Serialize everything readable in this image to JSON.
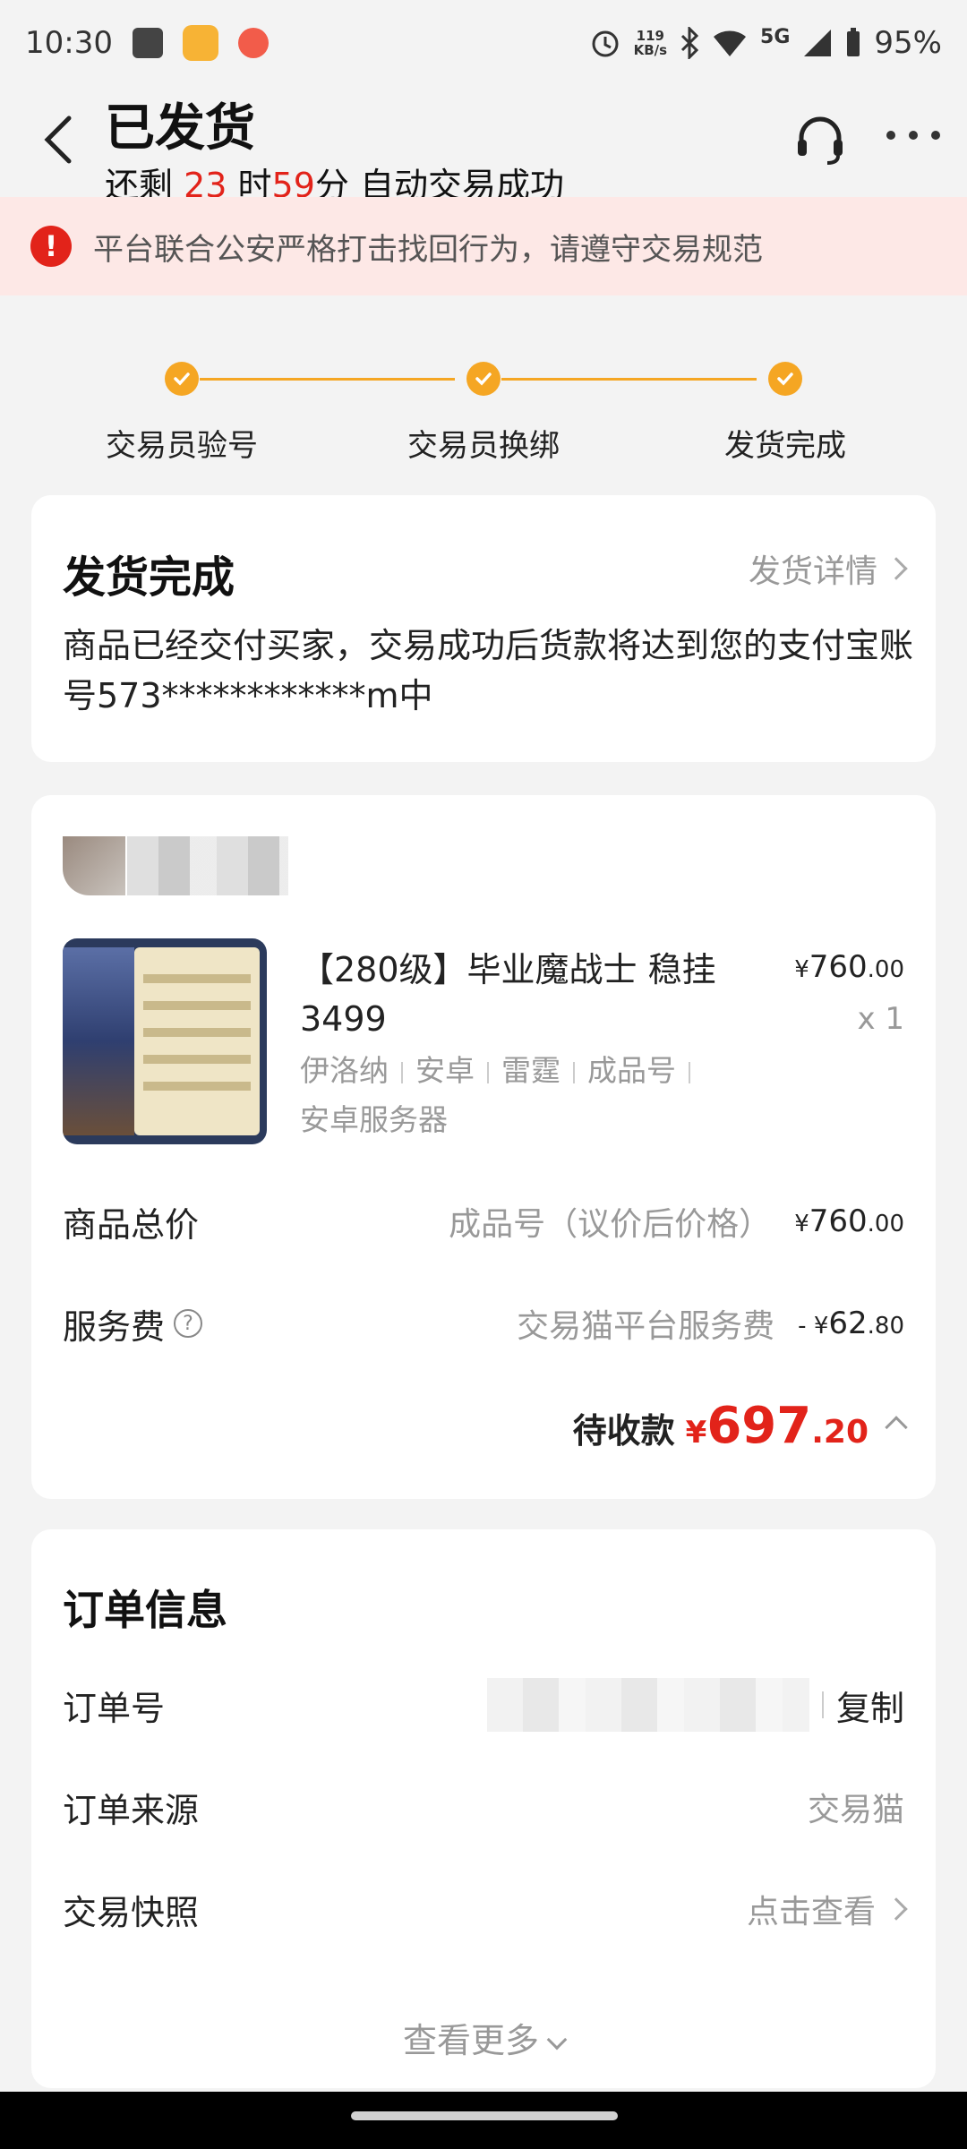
{
  "status_bar": {
    "time": "10:30",
    "net_speed_value": "119",
    "net_speed_unit": "KB/s",
    "network": "5G",
    "battery": "95%"
  },
  "header": {
    "title": "已发货",
    "countdown_prefix": "还剩 ",
    "hours": "23",
    "hours_unit": " 时",
    "minutes": "59",
    "minutes_unit": "分 自动交易成功"
  },
  "notice": {
    "icon": "!",
    "text": "平台联合公安严格打击找回行为，请遵守交易规范"
  },
  "steps": [
    {
      "label": "交易员验号"
    },
    {
      "label": "交易员换绑"
    },
    {
      "label": "发货完成"
    }
  ],
  "delivery_card": {
    "title": "发货完成",
    "detail_link": "发货详情",
    "description": "商品已经交付买家，交易成功后货款将达到您的支付宝账号573************m中"
  },
  "product": {
    "title": "【280级】毕业魔战士 稳挂3499",
    "tags": [
      "伊洛纳",
      "安卓",
      "雷霆",
      "成品号",
      "安卓服务器"
    ],
    "price_symbol": "¥",
    "price_int": "760",
    "price_dec": ".00",
    "quantity": "x 1"
  },
  "summary": {
    "total_label": "商品总价",
    "total_note": "成品号（议价后价格）",
    "total_symbol": "¥",
    "total_int": "760",
    "total_dec": ".00",
    "fee_label": "服务费",
    "fee_help": "?",
    "fee_note": "交易猫平台服务费",
    "fee_prefix": "- ¥",
    "fee_int": "62",
    "fee_dec": ".80",
    "receivable_label": "待收款",
    "receivable_symbol": "¥",
    "receivable_int": "697",
    "receivable_dec": ".20"
  },
  "order_info": {
    "title": "订单信息",
    "order_no_label": "订单号",
    "copy_label": "复制",
    "source_label": "订单来源",
    "source_value": "交易猫",
    "snapshot_label": "交易快照",
    "snapshot_value": "点击查看",
    "see_more": "查看更多"
  },
  "colors": {
    "accent_orange": "#f5a623",
    "alert_red": "#e2231a",
    "notice_bg": "#fde8e6"
  }
}
